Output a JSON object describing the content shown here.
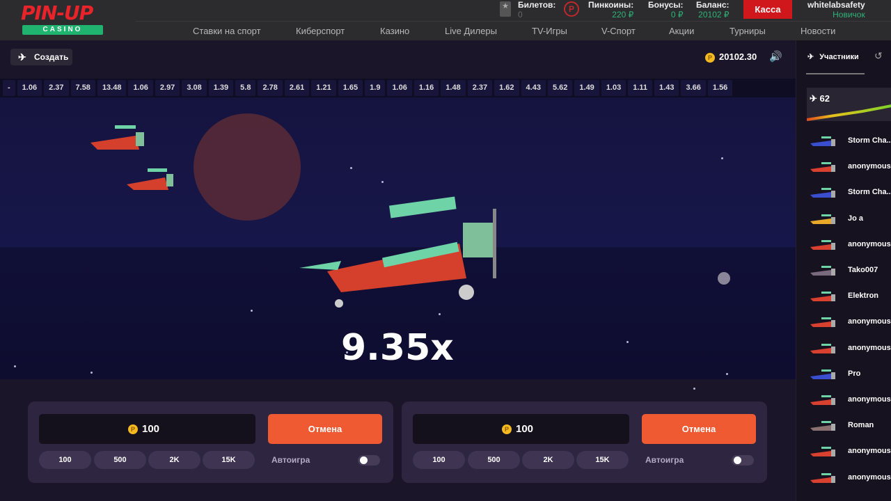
{
  "header": {
    "logo": "PIN-UP",
    "logo_sub": "CASINO",
    "tickets_label": "Билетов:",
    "tickets_value": "0",
    "pincoins_label": "Пинкоины:",
    "pincoins_value": "220 ₽",
    "bonus_label": "Бонусы:",
    "bonus_value": "0 ₽",
    "balance_label": "Баланс:",
    "balance_value": "20102 ₽",
    "cashier": "Касса",
    "username": "whitelabsafety",
    "status": "Новичок",
    "nav": [
      "Ставки на спорт",
      "Киберспорт",
      "Казино",
      "Live Дилеры",
      "TV-Игры",
      "V-Спорт",
      "Акции",
      "Турниры",
      "Новости"
    ]
  },
  "game": {
    "create_label": "Создать",
    "balance": "20102.30",
    "history": [
      "-",
      "1.06",
      "2.37",
      "7.58",
      "13.48",
      "1.06",
      "2.97",
      "3.08",
      "1.39",
      "5.8",
      "2.78",
      "2.61",
      "1.21",
      "1.65",
      "1.9",
      "1.06",
      "1.16",
      "1.48",
      "2.37",
      "1.62",
      "4.43",
      "5.62",
      "1.49",
      "1.03",
      "1.11",
      "1.43",
      "3.66",
      "1.56"
    ],
    "multiplier": "9.35x"
  },
  "bets": [
    {
      "amount": "100",
      "action": "Отмена",
      "chips": [
        "100",
        "500",
        "2K",
        "15K"
      ],
      "auto": "Автоигра"
    },
    {
      "amount": "100",
      "action": "Отмена",
      "chips": [
        "100",
        "500",
        "2K",
        "15K"
      ],
      "auto": "Автоигра"
    }
  ],
  "sidebar": {
    "tab": "Участники",
    "count": "62",
    "players": [
      "Storm Cha..",
      "anonymous",
      "Storm Cha..",
      "Jo a",
      "anonymous",
      "Tako007",
      "Elektron",
      "anonymous",
      "anonymous",
      "Pro",
      "anonymous",
      "Roman",
      "anonymous",
      "anonymous"
    ],
    "plane_colors": [
      "#3a4fd0",
      "#d8402f",
      "#3a4fd0",
      "#e8a92a",
      "#d8402f",
      "#7a6a80",
      "#d8402f",
      "#d8402f",
      "#d8402f",
      "#3a4fd0",
      "#d8402f",
      "#8a7070",
      "#d8402f",
      "#d8402f"
    ]
  },
  "colors": {
    "accent": "#ef5a33",
    "cashier": "#d0171c",
    "green": "#2fb37a"
  }
}
